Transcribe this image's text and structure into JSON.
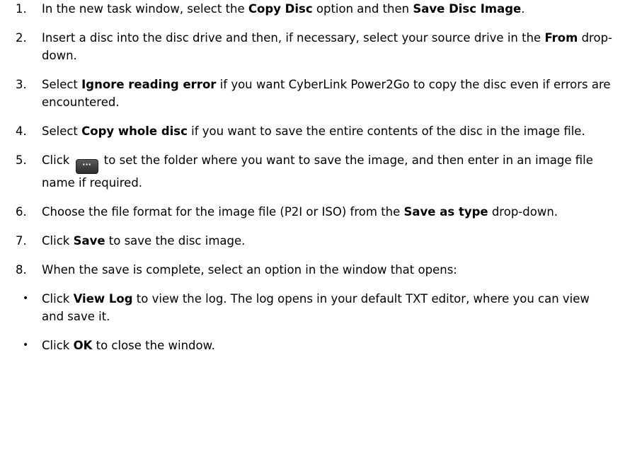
{
  "steps": [
    {
      "num": "1.",
      "parts": [
        "In the new task window, select the ",
        "Copy Disc",
        " option and then ",
        "Save Disc Image",
        "."
      ]
    },
    {
      "num": "2.",
      "parts": [
        "Insert a disc into the disc drive and then, if necessary, select your source drive in the ",
        "From",
        " drop-down."
      ]
    },
    {
      "num": "3.",
      "parts": [
        "Select ",
        "Ignore reading error",
        " if you want CyberLink Power2Go to copy the disc even if errors are encountered."
      ]
    },
    {
      "num": "4.",
      "parts": [
        "Select ",
        "Copy whole disc",
        " if you want to save the entire contents of the disc in the image file."
      ]
    },
    {
      "num": "5.",
      "parts": [
        "Click ",
        " to set the folder where you want to save the image, and then enter in an image file name if required."
      ],
      "button_icon": "ellipsis-icon",
      "button_glyph": "···"
    },
    {
      "num": "6.",
      "parts": [
        "Choose the file format for the image file (P2I or ISO) from the ",
        "Save as type",
        " drop-down."
      ]
    },
    {
      "num": "7.",
      "parts": [
        "Click ",
        "Save",
        " to save the disc image."
      ]
    },
    {
      "num": "8.",
      "parts": [
        "When the save is complete, select an option in the window that opens:"
      ]
    }
  ],
  "bullets": [
    {
      "marker": "•",
      "parts": [
        "Click ",
        "View Log",
        " to view the log. The log opens in your default TXT editor, where you can view and save it."
      ]
    },
    {
      "marker": "•",
      "parts": [
        "Click ",
        "OK",
        " to close the window."
      ]
    }
  ]
}
